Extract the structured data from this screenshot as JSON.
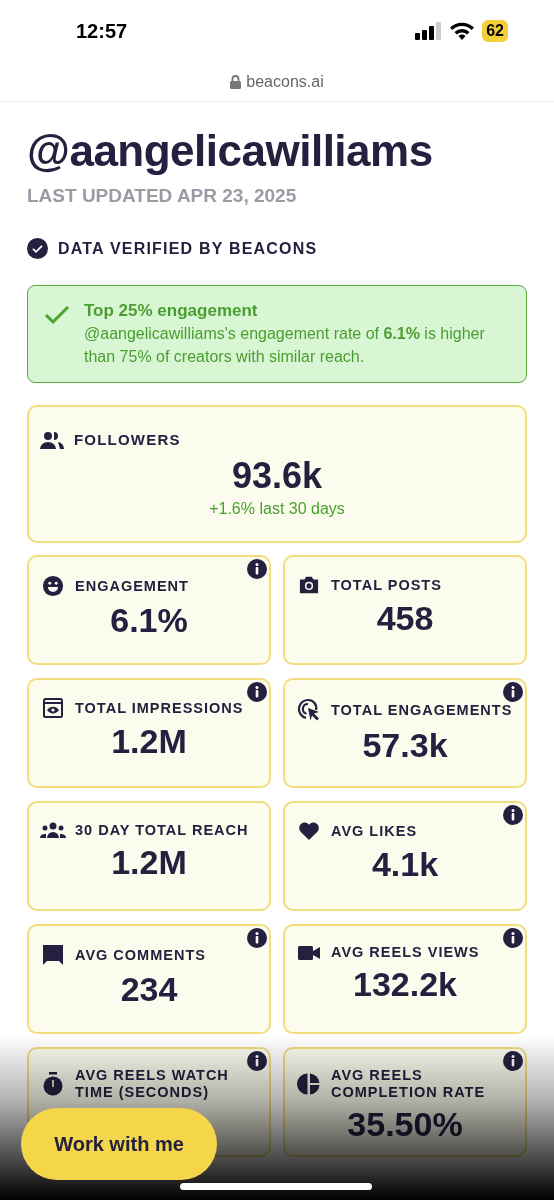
{
  "status_bar": {
    "time": "12:57",
    "battery": "62"
  },
  "url_bar": {
    "domain": "beacons.ai"
  },
  "profile": {
    "handle": "@aangelicawilliams",
    "updated": "LAST UPDATED APR 23, 2025",
    "verified": "DATA VERIFIED BY BEACONS"
  },
  "highlight": {
    "title": "Top 25% engagement",
    "text": "@aangelicawilliams's engagement rate of **6.1%** is higher than 75% of creators with similar reach."
  },
  "followers": {
    "label": "FOLLOWERS",
    "value": "93.6k",
    "change": "+1.6% last 30 days"
  },
  "stats": [
    {
      "kind": "smile",
      "label": "ENGAGEMENT",
      "value": "6.1%",
      "info": true
    },
    {
      "kind": "camera",
      "label": "TOTAL POSTS",
      "value": "458",
      "info": false
    },
    {
      "kind": "eye",
      "label": "TOTAL IMPRESSIONS",
      "value": "1.2M",
      "info": true
    },
    {
      "kind": "click",
      "label": "TOTAL ENGAGEMENTS",
      "value": "57.3k",
      "info": true
    },
    {
      "kind": "group",
      "label": "30 DAY TOTAL REACH",
      "value": "1.2M",
      "info": false
    },
    {
      "kind": "heart",
      "label": "AVG LIKES",
      "value": "4.1k",
      "info": true
    },
    {
      "kind": "comment",
      "label": "AVG COMMENTS",
      "value": "234",
      "info": true
    },
    {
      "kind": "video",
      "label": "AVG REELS VIEWS",
      "value": "132.2k",
      "info": true
    },
    {
      "kind": "timer",
      "label": "AVG REELS WATCH TIME (SECONDS)",
      "info": true
    },
    {
      "kind": "pie",
      "label": "AVG REELS COMPLETION RATE",
      "value": "35.50%",
      "info": true
    }
  ],
  "cta_button": "Work with me"
}
